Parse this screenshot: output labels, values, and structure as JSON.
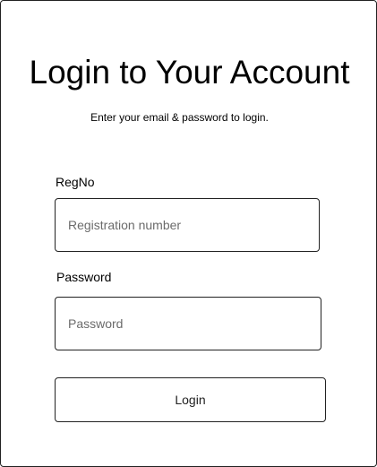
{
  "login": {
    "title": "Login to Your Account",
    "subtitle": "Enter your email & password to login.",
    "regno": {
      "label": "RegNo",
      "placeholder": "Registration number",
      "value": ""
    },
    "password": {
      "label": "Password",
      "placeholder": "Password",
      "value": ""
    },
    "submit_label": "Login"
  }
}
